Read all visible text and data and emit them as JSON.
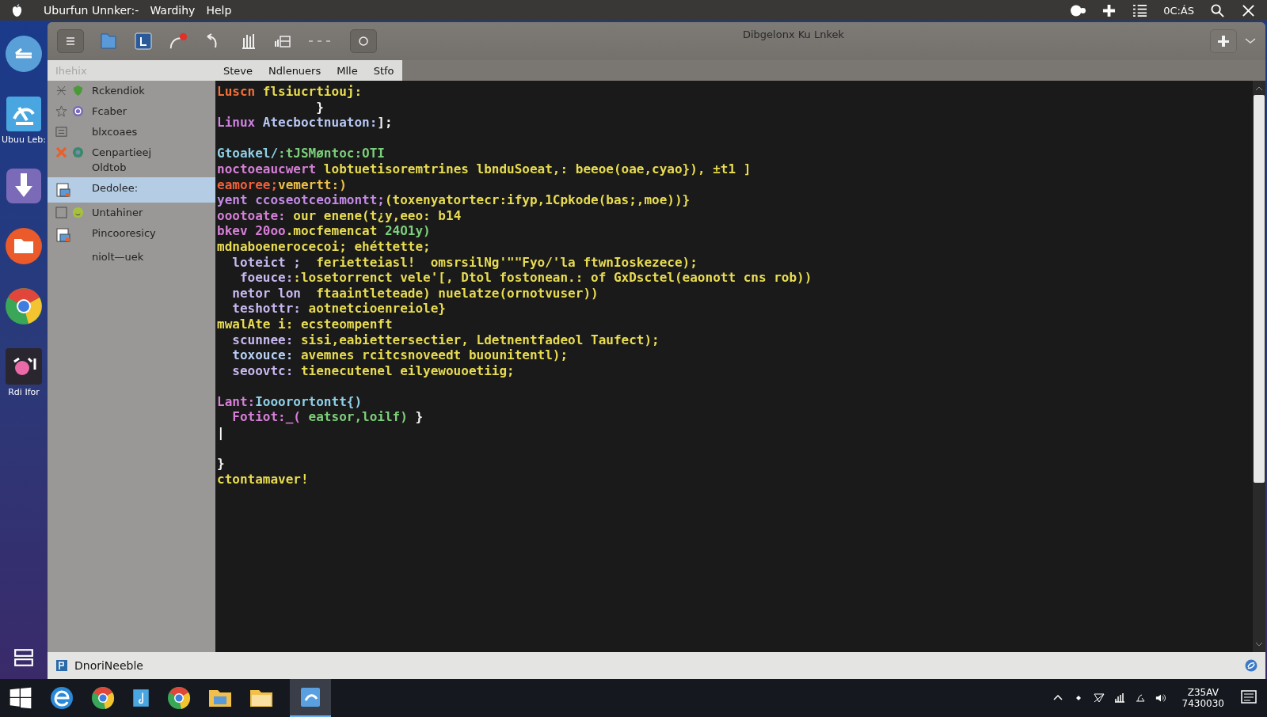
{
  "menu_bar": {
    "items": [
      "Uburfun Unnker:-",
      "Wardihy",
      "Help"
    ],
    "clock": "0C:ÁS"
  },
  "dock": {
    "labels": [
      "Ubuu Leb:",
      "Rdi Ifor"
    ]
  },
  "window": {
    "title": "Dibgelonx Ku Lnkek"
  },
  "sidebar": {
    "placeholder": "Ihehix",
    "items": [
      {
        "label": "Rckendiok",
        "selected": false
      },
      {
        "label": "Fcaber",
        "selected": false
      },
      {
        "label": "blxcoaes",
        "selected": false
      },
      {
        "label": "Cenpartieej",
        "sublabel": "Oldtob",
        "selected": false
      },
      {
        "label": "Dedolee:",
        "selected": true
      },
      {
        "label": "Untahiner",
        "selected": false
      },
      {
        "label": "Pincooresicy",
        "selected": false
      },
      {
        "label": "niolt—uek",
        "selected": false
      }
    ]
  },
  "tabs": [
    {
      "label": "Steve",
      "selected": false
    },
    {
      "label": "Ndlenuers",
      "selected": false
    },
    {
      "label": "Mlle",
      "selected": false
    },
    {
      "label": "Stfo",
      "selected": false
    }
  ],
  "code_lines": [
    {
      "kind": "code",
      "segments": [
        {
          "text": "Luscn",
          "color": "#f0703a"
        },
        {
          "text": " flsiucrtiouj:",
          "color": "#e8dc50"
        }
      ]
    },
    {
      "kind": "code",
      "segments": [
        {
          "text": "             }",
          "color": "#f0f0f0"
        }
      ]
    },
    {
      "kind": "code",
      "segments": [
        {
          "text": "Linux",
          "color": "#cf80e0"
        },
        {
          "text": " Atecboctnuaton:",
          "color": "#b8c8f5"
        },
        {
          "text": "];",
          "color": "#f0f0f0"
        }
      ]
    },
    {
      "kind": "blank"
    },
    {
      "kind": "code",
      "segments": [
        {
          "text": "Gtoakel/",
          "color": "#8fd0e8"
        },
        {
          "text": ":tJSMøntoc:OTI",
          "color": "#7ccf7a"
        }
      ]
    },
    {
      "kind": "code",
      "segments": [
        {
          "text": "noctoeaucwert",
          "color": "#d77fd8"
        },
        {
          "text": " lobtuetisoremtrines lbnduSoeat,: beeoe(oae,cyao}), ±t1 ]",
          "color": "#e8dc50"
        }
      ]
    },
    {
      "kind": "code",
      "segments": [
        {
          "text": "eamoree;",
          "color": "#f0603a"
        },
        {
          "text": "vemertt:)",
          "color": "#eec048"
        }
      ]
    },
    {
      "kind": "code",
      "segments": [
        {
          "text": "yent ccoseotceoimontt;",
          "color": "#c58be8"
        },
        {
          "text": "(toxenyatortecr:ifyp,1Cpkode(bas;,moe))}",
          "color": "#e8dc50"
        }
      ]
    },
    {
      "kind": "code",
      "segments": [
        {
          "text": "oootoate:",
          "color": "#d77fd8"
        },
        {
          "text": " our enene(t¿y,eeo: b14",
          "color": "#e8dc50"
        }
      ]
    },
    {
      "kind": "code",
      "segments": [
        {
          "text": "bkev 20oo",
          "color": "#d77fd8"
        },
        {
          "text": ".mocfemencat",
          "color": "#e8dc50"
        },
        {
          "text": " 24O1y)",
          "color": "#7ccf7a"
        }
      ]
    },
    {
      "kind": "code",
      "segments": [
        {
          "text": "mdnaboenerocecoi; ehéttette;",
          "color": "#e8dc50"
        }
      ]
    },
    {
      "kind": "code",
      "segments": [
        {
          "text": "  loteict ;",
          "color": "#c8b8f0"
        },
        {
          "text": "  ferietteiasl!  omsrsilNg'\"\"Fyo/'la ftwnIoskezece);",
          "color": "#e8dc50"
        }
      ]
    },
    {
      "kind": "code",
      "segments": [
        {
          "text": "   foeuce:",
          "color": "#c8b8f0"
        },
        {
          "text": ":losetorrenct vele'[, Dtol fostonean.: of GxDsctel(eaonott cns rob))",
          "color": "#e8dc50"
        }
      ]
    },
    {
      "kind": "code",
      "segments": [
        {
          "text": "  netor lon",
          "color": "#c8b8f0"
        },
        {
          "text": "  ftaaintleteade) nuelatze(ornotvuser))",
          "color": "#e8dc50"
        }
      ]
    },
    {
      "kind": "code",
      "segments": [
        {
          "text": "  teshottr:",
          "color": "#c8b8f0"
        },
        {
          "text": " aotnetcioenreiole}",
          "color": "#e8dc50"
        }
      ]
    },
    {
      "kind": "code",
      "segments": [
        {
          "text": "mwalAte i: ecsteompenft",
          "color": "#e8dc50"
        }
      ]
    },
    {
      "kind": "code",
      "segments": [
        {
          "text": "  scunnee:",
          "color": "#c8b8f0"
        },
        {
          "text": " sisi,eabiettersectier, Ldetnentfadeol Taufect);",
          "color": "#e8dc50"
        }
      ]
    },
    {
      "kind": "code",
      "segments": [
        {
          "text": "  toxouce:",
          "color": "#b8d0f5"
        },
        {
          "text": " avemnes rcitcsnoveedt buounitentl);",
          "color": "#e8dc50"
        }
      ]
    },
    {
      "kind": "code",
      "segments": [
        {
          "text": "  seoovtc:",
          "color": "#c8b8f0"
        },
        {
          "text": " tienecutenel eilyewouoetiig;",
          "color": "#e8dc50"
        }
      ]
    },
    {
      "kind": "blank"
    },
    {
      "kind": "code",
      "segments": [
        {
          "text": "Lant:",
          "color": "#d77fd8"
        },
        {
          "text": "Iooorortontt{)",
          "color": "#8fd0e8"
        }
      ]
    },
    {
      "kind": "code",
      "segments": [
        {
          "text": "  Fotiot:_(",
          "color": "#d77fd8"
        },
        {
          "text": " eatsor,loilf)",
          "color": "#7ccf7a"
        },
        {
          "text": " }",
          "color": "#f0f0f0"
        }
      ]
    },
    {
      "kind": "code",
      "segments": [
        {
          "text": "|",
          "color": "#ffffff"
        }
      ]
    },
    {
      "kind": "blank"
    },
    {
      "kind": "code",
      "segments": [
        {
          "text": "}",
          "color": "#f0f0f0"
        }
      ]
    },
    {
      "kind": "code",
      "segments": [
        {
          "text": "ctontamaver!",
          "color": "#e8dc50"
        }
      ]
    }
  ],
  "status_bar": {
    "text": "DnoriNeeble"
  },
  "taskbar": {
    "time": "Z35AV",
    "date": "7430030"
  }
}
